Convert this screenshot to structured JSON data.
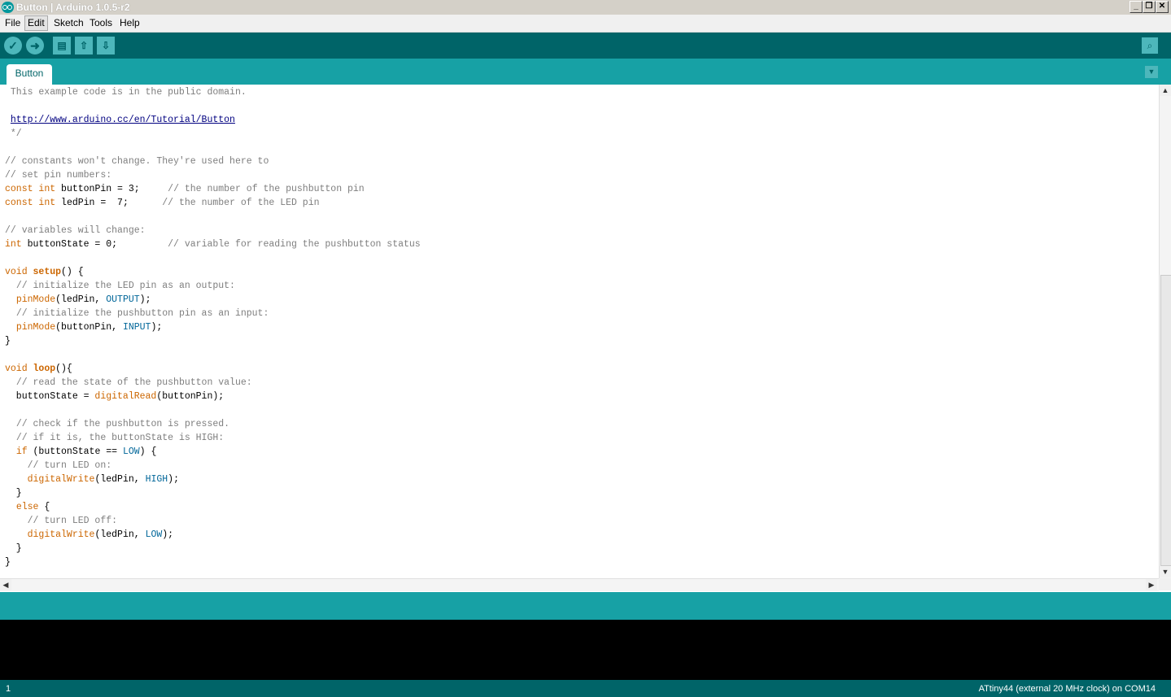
{
  "window": {
    "title": "Button | Arduino 1.0.5-r2"
  },
  "menu": {
    "items": [
      "File",
      "Edit",
      "Sketch",
      "Tools",
      "Help"
    ],
    "active": "Edit"
  },
  "toolbar": {
    "verify_icon": "check-icon",
    "upload_icon": "arrow-right-icon",
    "new_icon": "file-icon",
    "open_icon": "arrow-up-icon",
    "save_icon": "arrow-down-icon",
    "serial_icon": "magnifier-icon"
  },
  "tabs": [
    {
      "label": "Button"
    }
  ],
  "code_lines": [
    [
      {
        "t": " This example code is in the public domain.",
        "c": "cm"
      }
    ],
    [],
    [
      {
        "t": " ",
        "c": ""
      },
      {
        "t": "http://www.arduino.cc/en/Tutorial/Button",
        "c": "url"
      }
    ],
    [
      {
        "t": " */",
        "c": "cm"
      }
    ],
    [],
    [
      {
        "t": "// constants won't change. They're used here to",
        "c": "cm"
      }
    ],
    [
      {
        "t": "// set pin numbers:",
        "c": "cm"
      }
    ],
    [
      {
        "t": "const",
        "c": "kw"
      },
      {
        "t": " ",
        "c": ""
      },
      {
        "t": "int",
        "c": "kw"
      },
      {
        "t": " buttonPin = 3;     ",
        "c": ""
      },
      {
        "t": "// the number of the pushbutton pin",
        "c": "cm"
      }
    ],
    [
      {
        "t": "const",
        "c": "kw"
      },
      {
        "t": " ",
        "c": ""
      },
      {
        "t": "int",
        "c": "kw"
      },
      {
        "t": " ledPin =  7;      ",
        "c": ""
      },
      {
        "t": "// the number of the LED pin",
        "c": "cm"
      }
    ],
    [],
    [
      {
        "t": "// variables will change:",
        "c": "cm"
      }
    ],
    [
      {
        "t": "int",
        "c": "kw"
      },
      {
        "t": " buttonState = 0;         ",
        "c": ""
      },
      {
        "t": "// variable for reading the pushbutton status",
        "c": "cm"
      }
    ],
    [],
    [
      {
        "t": "void",
        "c": "kw"
      },
      {
        "t": " ",
        "c": ""
      },
      {
        "t": "setup",
        "c": "kw2"
      },
      {
        "t": "() {",
        "c": ""
      }
    ],
    [
      {
        "t": "  ",
        "c": ""
      },
      {
        "t": "// initialize the LED pin as an output:",
        "c": "cm"
      }
    ],
    [
      {
        "t": "  ",
        "c": ""
      },
      {
        "t": "pinMode",
        "c": "kw"
      },
      {
        "t": "(ledPin, ",
        "c": ""
      },
      {
        "t": "OUTPUT",
        "c": "cn"
      },
      {
        "t": ");",
        "c": ""
      }
    ],
    [
      {
        "t": "  ",
        "c": ""
      },
      {
        "t": "// initialize the pushbutton pin as an input:",
        "c": "cm"
      }
    ],
    [
      {
        "t": "  ",
        "c": ""
      },
      {
        "t": "pinMode",
        "c": "kw"
      },
      {
        "t": "(buttonPin, ",
        "c": ""
      },
      {
        "t": "INPUT",
        "c": "cn"
      },
      {
        "t": ");",
        "c": ""
      }
    ],
    [
      {
        "t": "}",
        "c": ""
      }
    ],
    [],
    [
      {
        "t": "void",
        "c": "kw"
      },
      {
        "t": " ",
        "c": ""
      },
      {
        "t": "loop",
        "c": "kw2"
      },
      {
        "t": "(){",
        "c": ""
      }
    ],
    [
      {
        "t": "  ",
        "c": ""
      },
      {
        "t": "// read the state of the pushbutton value:",
        "c": "cm"
      }
    ],
    [
      {
        "t": "  buttonState = ",
        "c": ""
      },
      {
        "t": "digitalRead",
        "c": "kw"
      },
      {
        "t": "(buttonPin);",
        "c": ""
      }
    ],
    [],
    [
      {
        "t": "  ",
        "c": ""
      },
      {
        "t": "// check if the pushbutton is pressed.",
        "c": "cm"
      }
    ],
    [
      {
        "t": "  ",
        "c": ""
      },
      {
        "t": "// if it is, the buttonState is HIGH:",
        "c": "cm"
      }
    ],
    [
      {
        "t": "  ",
        "c": ""
      },
      {
        "t": "if",
        "c": "kw"
      },
      {
        "t": " (buttonState == ",
        "c": ""
      },
      {
        "t": "LOW",
        "c": "cn"
      },
      {
        "t": ") {",
        "c": ""
      }
    ],
    [
      {
        "t": "    ",
        "c": ""
      },
      {
        "t": "// turn LED on:",
        "c": "cm"
      }
    ],
    [
      {
        "t": "    ",
        "c": ""
      },
      {
        "t": "digitalWrite",
        "c": "kw"
      },
      {
        "t": "(ledPin, ",
        "c": ""
      },
      {
        "t": "HIGH",
        "c": "cn"
      },
      {
        "t": ");",
        "c": ""
      }
    ],
    [
      {
        "t": "  }",
        "c": ""
      }
    ],
    [
      {
        "t": "  ",
        "c": ""
      },
      {
        "t": "else",
        "c": "kw"
      },
      {
        "t": " {",
        "c": ""
      }
    ],
    [
      {
        "t": "    ",
        "c": ""
      },
      {
        "t": "// turn LED off:",
        "c": "cm"
      }
    ],
    [
      {
        "t": "    ",
        "c": ""
      },
      {
        "t": "digitalWrite",
        "c": "kw"
      },
      {
        "t": "(ledPin, ",
        "c": ""
      },
      {
        "t": "LOW",
        "c": "cn"
      },
      {
        "t": ");",
        "c": ""
      }
    ],
    [
      {
        "t": "  }",
        "c": ""
      }
    ],
    [
      {
        "t": "}",
        "c": ""
      }
    ]
  ],
  "status": {
    "line_number": "1",
    "board": "ATtiny44 (external 20 MHz clock) on COM14"
  },
  "colors": {
    "toolbar": "#006468",
    "tabbar": "#17a1a5",
    "console": "#000000",
    "keyword": "#cc6600",
    "constant": "#006699",
    "comment": "#7e7e7e"
  }
}
